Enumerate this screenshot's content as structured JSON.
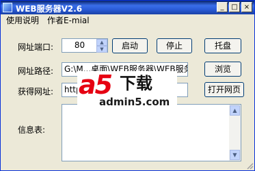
{
  "window": {
    "title": "WEB服务器V2.6"
  },
  "title_buttons": {
    "minimize": "_",
    "maximize": "□",
    "close": "×"
  },
  "menu": {
    "items": [
      "使用说明",
      "作者E-mial"
    ]
  },
  "labels": {
    "port": "网址端口:",
    "path": "网址路径:",
    "url": "获得网址:",
    "info": "信息表:"
  },
  "port": {
    "value": "80"
  },
  "buttons": {
    "start": "启动",
    "stop": "停止",
    "tray": "托盘",
    "browse": "浏览",
    "open_page": "打开网页"
  },
  "path": {
    "value": "G:\\M...桌面\\WEB服务器\\WEB服务器"
  },
  "url": {
    "value": "http"
  },
  "info": {
    "value": ""
  },
  "watermark": {
    "logo": "a5",
    "text": "下载",
    "site": "admin5.com"
  },
  "colors": {
    "title_bar": "#2a5bd7",
    "watermark_red": "#e60012"
  }
}
